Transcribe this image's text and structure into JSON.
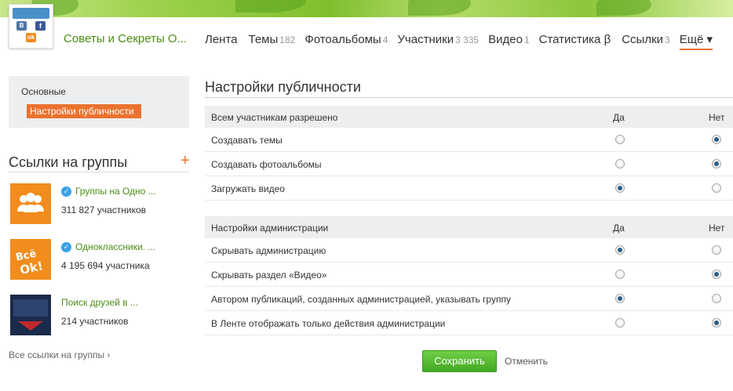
{
  "header": {
    "group_name": "Советы и Секреты О...",
    "nav": [
      {
        "label": "Лента",
        "count": ""
      },
      {
        "label": "Темы",
        "count": "182"
      },
      {
        "label": "Фотоальбомы",
        "count": "4"
      },
      {
        "label": "Участники",
        "count": "3 335"
      },
      {
        "label": "Видео",
        "count": "1"
      },
      {
        "label": "Статистика β",
        "count": ""
      },
      {
        "label": "Ссылки",
        "count": "3"
      }
    ],
    "more_label": "Ещё ▾",
    "logo_icons": {
      "vk": "В",
      "fb": "f",
      "ok": "ok"
    }
  },
  "sidebar": {
    "menu": {
      "basic": "Основные",
      "public": "Настройки публичности"
    },
    "links_title": "Ссылки на группы",
    "add_label": "+",
    "groups": [
      {
        "title": "Группы на Одно ...",
        "members": "311 827 участников",
        "verified": true,
        "thumb": "people-icon",
        "thumb_color": "#f28c1c"
      },
      {
        "title": "Одноклассники. ...",
        "members": "4 195 694 участника",
        "verified": true,
        "thumb": "vse-ok-logo",
        "thumb_color": "#f28c1c"
      },
      {
        "title": "Поиск друзей в ...",
        "members": "214 участников",
        "verified": false,
        "thumb": "search-friends-thumb",
        "thumb_color": "#1a2a4a"
      }
    ],
    "all_links": "Все ссылки на группы ›"
  },
  "main": {
    "title": "Настройки публичности",
    "sections": [
      {
        "header": "Всем участникам разрешено",
        "yes": "Да",
        "no": "Нет",
        "rows": [
          {
            "label": "Создавать темы",
            "value": "no"
          },
          {
            "label": "Создавать фотоальбомы",
            "value": "no"
          },
          {
            "label": "Загружать видео",
            "value": "yes"
          }
        ]
      },
      {
        "header": "Настройки администрации",
        "yes": "Да",
        "no": "Нет",
        "rows": [
          {
            "label": "Скрывать администрацию",
            "value": "yes"
          },
          {
            "label": "Скрывать раздел «Видео»",
            "value": "no"
          },
          {
            "label": "Автором публикаций, созданных администрацией, указывать группу",
            "value": "yes"
          },
          {
            "label": "В Ленте отображать только действия администрации",
            "value": "no"
          }
        ]
      }
    ],
    "save_label": "Сохранить",
    "cancel_label": "Отменить"
  },
  "colors": {
    "accent": "#eb722e",
    "link_green": "#4b8d14",
    "save_green": "#44a822",
    "radio_on": "#2a5f86"
  }
}
